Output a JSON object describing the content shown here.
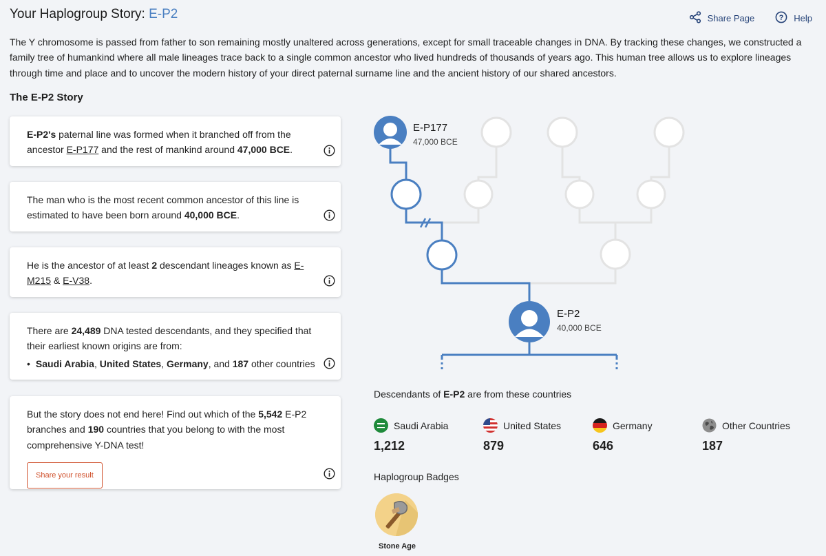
{
  "header": {
    "title_prefix": "Your Haplogroup Story: ",
    "haplogroup": "E-P2",
    "share_label": "Share Page",
    "help_label": "Help"
  },
  "intro": "The Y chromosome is passed from father to son remaining mostly unaltered across generations, except for small traceable changes in DNA. By tracking these changes, we constructed a family tree of humankind where all male lineages trace back to a single common ancestor who lived hundreds of thousands of years ago. This human tree allows us to explore lineages through time and place and to uncover the modern history of your direct paternal surname line and the ancient history of our shared ancestors.",
  "story": {
    "title": "The E-P2 Story",
    "card1": {
      "hg": "E-P2's",
      "t1": " paternal line was formed when it branched off from the ancestor ",
      "ancestor": "E-P177",
      "t2": " and the rest of mankind around ",
      "date": "47,000 BCE",
      "t3": "."
    },
    "card2": {
      "t1": "The man who is the most recent common ancestor of this line is estimated to have been born around ",
      "date": "40,000 BCE",
      "t2": "."
    },
    "card3": {
      "t1": "He is the ancestor of at least ",
      "count": "2",
      "t2": " descendant lineages known as ",
      "lin1": "E-M215",
      "amp": " & ",
      "lin2": "E-V38",
      "t3": "."
    },
    "card4": {
      "t1": "There are ",
      "count": "24,489",
      "t2": " DNA tested descendants, and they specified that their earliest known origins are from:",
      "c1": "Saudi Arabia",
      "sep1": ", ",
      "c2": "United States",
      "sep2": ", ",
      "c3": "Germany",
      "t3": ", and ",
      "others": "187",
      "t4": " other countries"
    },
    "card5": {
      "t1": "But the story does not end here! Find out which of the ",
      "branches": "5,542",
      "t2": " E-P2 branches and ",
      "countries": "190",
      "t3": " countries that you belong to with the most comprehensive Y-DNA test!",
      "button": "Share your result"
    }
  },
  "tree": {
    "ancestor_name": "E-P177",
    "ancestor_date": "47,000 BCE",
    "current_name": "E-P2",
    "current_date": "40,000 BCE",
    "line_color": "#4a7fc1",
    "faded_color": "#e3e3e3"
  },
  "descendants": {
    "title_prefix": "Descendants of ",
    "hg": "E-P2",
    "title_suffix": " are from these countries",
    "countries": [
      {
        "name": "Saudi Arabia",
        "count": "1,212",
        "flag": "saudi-flag-icon"
      },
      {
        "name": "United States",
        "count": "879",
        "flag": "us-flag-icon"
      },
      {
        "name": "Germany",
        "count": "646",
        "flag": "germany-flag-icon"
      },
      {
        "name": "Other Countries",
        "count": "187",
        "flag": "globe-icon"
      }
    ]
  },
  "badges": {
    "title": "Haplogroup Badges",
    "items": [
      {
        "label": "Stone Age",
        "icon": "stone-axe-icon"
      }
    ]
  }
}
